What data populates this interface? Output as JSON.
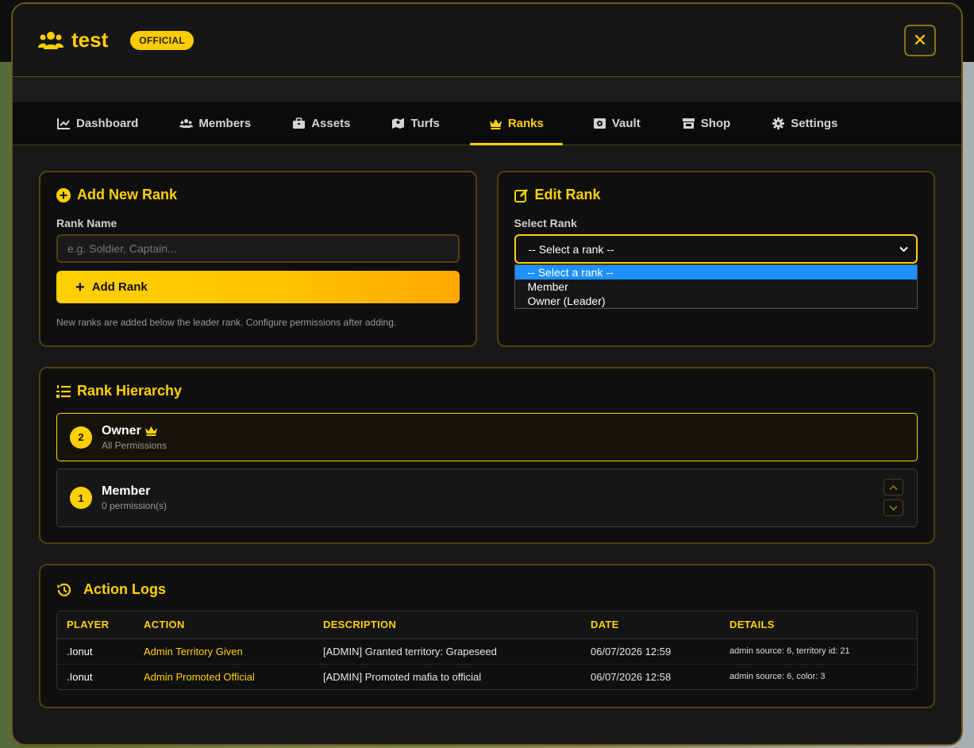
{
  "header": {
    "title": "test",
    "badge": "OFFICIAL",
    "close_label": "✕"
  },
  "tabs": [
    {
      "label": "Dashboard",
      "icon": "chart-line-icon"
    },
    {
      "label": "Members",
      "icon": "users-icon"
    },
    {
      "label": "Assets",
      "icon": "briefcase-icon"
    },
    {
      "label": "Turfs",
      "icon": "map-icon"
    },
    {
      "label": "Ranks",
      "icon": "crown-icon",
      "active": true
    },
    {
      "label": "Vault",
      "icon": "vault-icon"
    },
    {
      "label": "Shop",
      "icon": "store-icon"
    },
    {
      "label": "Settings",
      "icon": "gear-icon"
    }
  ],
  "add_rank": {
    "title": "Add New Rank",
    "field_label": "Rank Name",
    "placeholder": "e.g. Soldier, Captain...",
    "button_label": "Add Rank",
    "hint": "New ranks are added below the leader rank. Configure permissions after adding."
  },
  "edit_rank": {
    "title": "Edit Rank",
    "field_label": "Select Rank",
    "selected": "-- Select a rank --",
    "options": [
      "-- Select a rank --",
      "Member",
      "Owner (Leader)"
    ]
  },
  "hierarchy": {
    "title": "Rank Hierarchy",
    "ranks": [
      {
        "num": "2",
        "name": "Owner",
        "sub": "All Permissions"
      },
      {
        "num": "1",
        "name": "Member",
        "sub": "0 permission(s)"
      }
    ]
  },
  "logs": {
    "title": "Action Logs",
    "columns": [
      "PLAYER",
      "ACTION",
      "DESCRIPTION",
      "DATE",
      "DETAILS"
    ],
    "rows": [
      {
        "player": ".Ionut",
        "action": "Admin Territory Given",
        "description": "[ADMIN] Granted territory: Grapeseed",
        "date": "06/07/2026 12:59",
        "details": "admin source: 6, territory id: 21"
      },
      {
        "player": ".Ionut",
        "action": "Admin Promoted Official",
        "description": "[ADMIN] Promoted mafia to official",
        "date": "06/07/2026 12:58",
        "details": "admin source: 6, color: 3"
      }
    ]
  },
  "colors": {
    "accent": "#ffd000",
    "panel_border": "#4d4110",
    "background": "#171717"
  }
}
